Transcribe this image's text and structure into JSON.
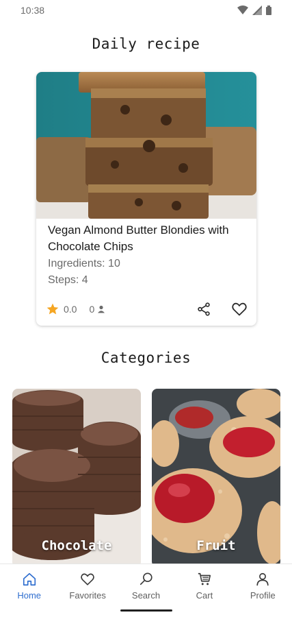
{
  "status_bar": {
    "time": "10:38"
  },
  "daily": {
    "title": "Daily recipe",
    "recipe": {
      "name": "Vegan Almond Butter Blondies with Chocolate Chips",
      "ingredients": "Ingredients: 10",
      "steps": "Steps: 4",
      "rating": "0.0",
      "cooks": "0"
    }
  },
  "categories": {
    "title": "Categories",
    "items": [
      {
        "label": "Chocolate"
      },
      {
        "label": "Fruit"
      }
    ]
  },
  "nav": {
    "items": [
      {
        "label": "Home",
        "icon": "home-icon"
      },
      {
        "label": "Favorites",
        "icon": "heart-icon"
      },
      {
        "label": "Search",
        "icon": "search-icon"
      },
      {
        "label": "Cart",
        "icon": "cart-icon"
      },
      {
        "label": "Profile",
        "icon": "person-icon"
      }
    ],
    "active": "Home"
  },
  "colors": {
    "accent": "#2f6ecf",
    "star": "#f5a623"
  }
}
